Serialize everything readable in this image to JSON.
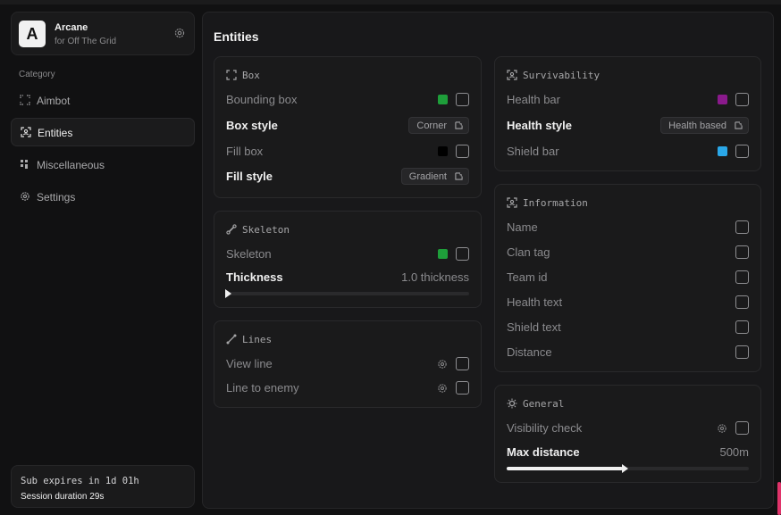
{
  "brand": {
    "logo_letter": "A",
    "title": "Arcane",
    "subtitle": "for Off The Grid",
    "settings_icon": "gear-icon"
  },
  "sidebar": {
    "category_label": "Category",
    "items": [
      {
        "label": "Aimbot",
        "icon": "crosshair-icon",
        "active": false
      },
      {
        "label": "Entities",
        "icon": "entities-icon",
        "active": true
      },
      {
        "label": "Miscellaneous",
        "icon": "misc-icon",
        "active": false
      },
      {
        "label": "Settings",
        "icon": "gear-icon",
        "active": false
      }
    ]
  },
  "subscription": {
    "expires": "Sub expires in 1d 01h",
    "session": "Session duration 29s"
  },
  "main": {
    "title": "Entities",
    "box": {
      "title": "Box",
      "bounding_box": "Bounding box",
      "box_style": "Box style",
      "box_style_value": "Corner",
      "fill_box": "Fill box",
      "fill_style": "Fill style",
      "fill_style_value": "Gradient",
      "bounding_color": "#1e9e3a",
      "fill_color": "#000000"
    },
    "skeleton": {
      "title": "Skeleton",
      "skeleton": "Skeleton",
      "skeleton_color": "#1e9e3a",
      "thickness": "Thickness",
      "thickness_value": "1.0 thickness",
      "thickness_fraction": 0.0
    },
    "lines": {
      "title": "Lines",
      "view_line": "View line",
      "line_to_enemy": "Line to enemy"
    },
    "survivability": {
      "title": "Survivability",
      "health_bar": "Health bar",
      "health_bar_color": "#8a1a8c",
      "health_style": "Health style",
      "health_style_value": "Health based",
      "shield_bar": "Shield bar",
      "shield_bar_color": "#2aa7e8"
    },
    "information": {
      "title": "Information",
      "items": [
        "Name",
        "Clan tag",
        "Team id",
        "Health text",
        "Shield text",
        "Distance"
      ]
    },
    "general": {
      "title": "General",
      "visibility_check": "Visibility check",
      "max_distance": "Max distance",
      "max_distance_value": "500m",
      "max_distance_fraction": 0.48
    }
  }
}
